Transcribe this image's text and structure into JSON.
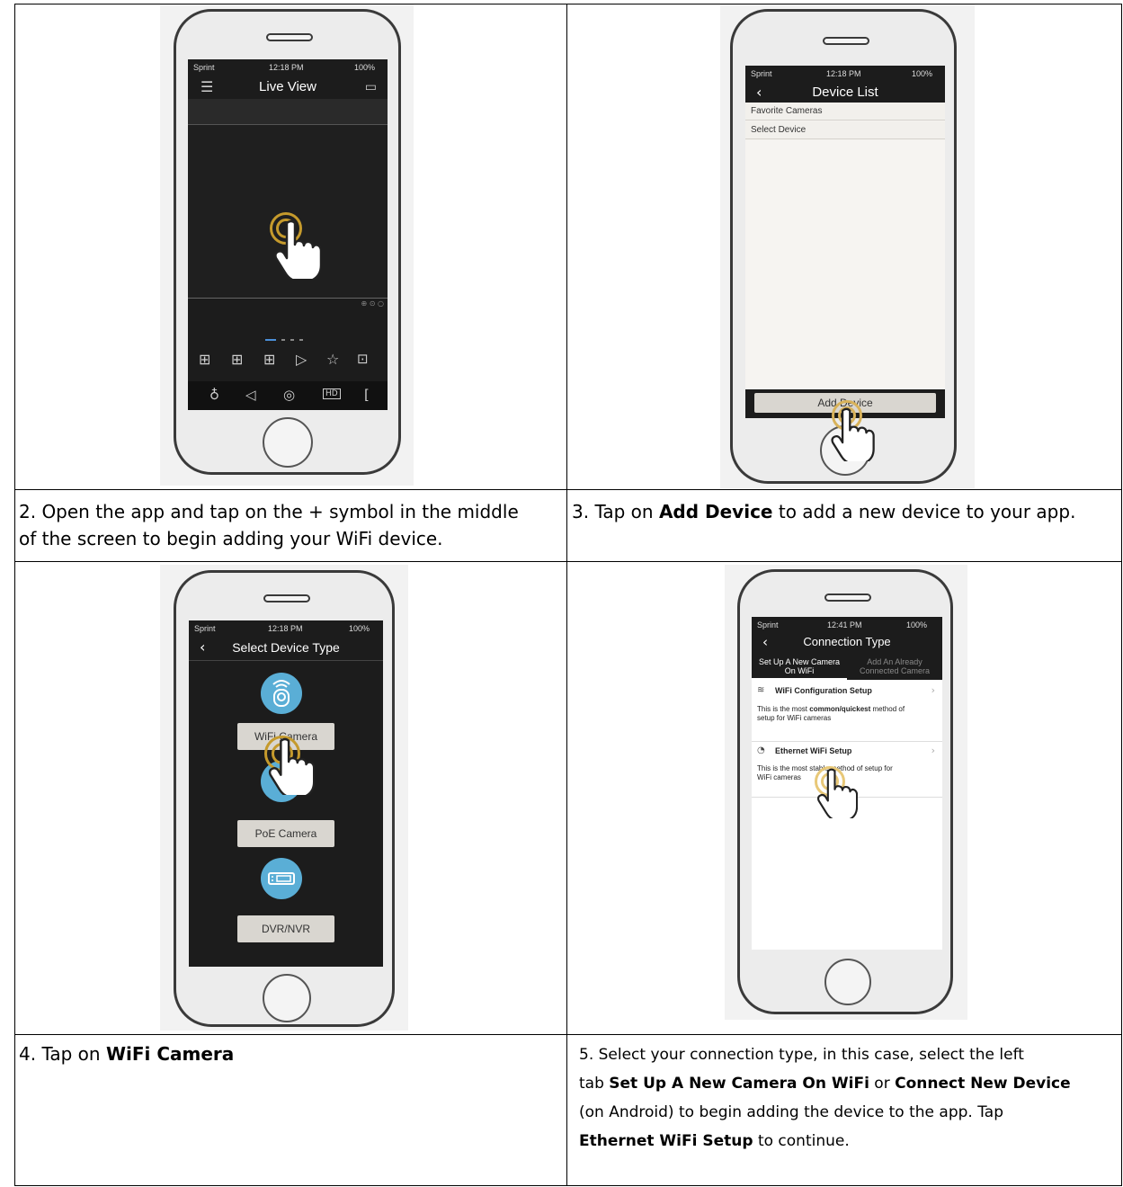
{
  "steps": [
    {
      "caption_line1": "2. Open the app and tap on the + symbol in the middle",
      "caption_line2": "of the screen to begin adding your WiFi device.",
      "screen": {
        "carrier": "Sprint",
        "time": "12:18 PM",
        "battery": "100%",
        "title": "Live View",
        "hd_label": "HD"
      }
    },
    {
      "caption_prefix": "3. Tap on ",
      "caption_bold": "Add Device",
      "caption_suffix": " to add a new device to your app.",
      "screen": {
        "carrier": "Sprint",
        "time": "12:18 PM",
        "battery": "100%",
        "title": "Device List",
        "rows": [
          "Favorite Cameras",
          "Select Device"
        ],
        "button": "Add Device"
      }
    },
    {
      "caption_prefix": "4. Tap on ",
      "caption_bold": "WiFi Camera",
      "screen": {
        "carrier": "Sprint",
        "time": "12:18 PM",
        "battery": "100%",
        "title": "Select Device Type",
        "buttons": [
          "WiFi Camera",
          "PoE Camera",
          "DVR/NVR"
        ]
      }
    },
    {
      "caption": {
        "p1": "5. Select your connection type, in this case, select the left",
        "p2_a": "tab ",
        "p2_b": "Set Up A New Camera On WiFi",
        "p2_c": " or ",
        "p2_d": "Connect New Device",
        "p3": "(on Android) to begin adding the device to the app. Tap",
        "p4_bold": "Ethernet WiFi Setup",
        "p4_rest": " to continue."
      },
      "screen": {
        "carrier": "Sprint",
        "time": "12:41 PM",
        "battery": "100%",
        "title": "Connection Type",
        "tab_left_1": "Set Up A New Camera",
        "tab_left_2": "On WiFi",
        "tab_right_1": "Add An Already",
        "tab_right_2": "Connected Camera",
        "opt1_title": "WiFi Configuration Setup",
        "opt1_desc_a": "This is the most ",
        "opt1_desc_bold": "common/quickest",
        "opt1_desc_b": " method of",
        "opt1_desc_c": "setup for WiFi cameras",
        "opt2_title": "Ethernet WiFi Setup",
        "opt2_desc_a": "This is the most stable method of setup for",
        "opt2_desc_b": "WiFi cameras"
      }
    }
  ]
}
